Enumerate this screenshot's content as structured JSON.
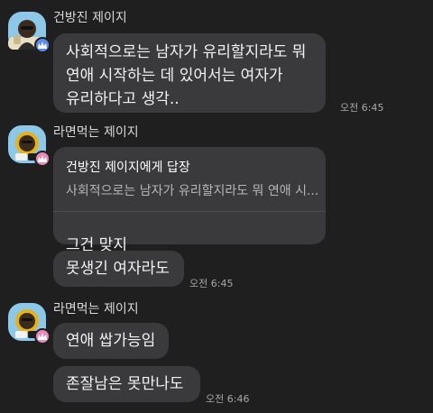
{
  "colors": {
    "background": "#1f1f1f",
    "bubble": "#3a3a3c",
    "badge_crown": "#5a8be8",
    "badge_crown_pink": "#e88ab8"
  },
  "messages": {
    "group1": {
      "sender": "건방진 제이지",
      "avatar_icon": "jay-g-avatar-icon",
      "badge_icon": "crown-badge-icon",
      "text": "사회적으로는 남자가 유리할지라도 뭐\n연애 시작하는 데 있어서는 여자가\n유리하다고 생각..",
      "time": "오전 6:45"
    },
    "group2": {
      "sender": "라면먹는 제이지",
      "avatar_icon": "jay-g-ramen-avatar-icon",
      "badge_icon": "crown-badge-icon",
      "reply_header": "건방진 제이지에게 답장",
      "reply_quote": "사회적으로는 남자가 유리할지라도 뭐 연애 시...",
      "reply_answer": "그건 맞지",
      "text2": "못생긴 여자라도",
      "time": "오전 6:45"
    },
    "group3": {
      "sender": "라면먹는 제이지",
      "avatar_icon": "jay-g-ramen-avatar-icon",
      "badge_icon": "crown-badge-icon",
      "text1": "연애 쌉가능임",
      "text2": "존잘남은 못만나도",
      "time": "오전 6:46"
    }
  }
}
